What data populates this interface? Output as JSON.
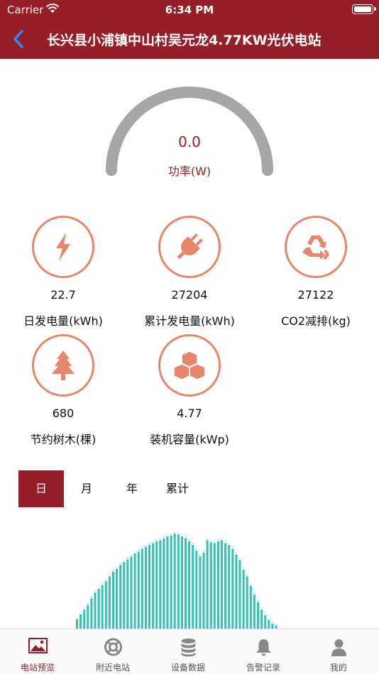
{
  "status_bar": {
    "carrier": "Carrier",
    "time": "6:34 PM"
  },
  "header": {
    "title": "长兴县小浦镇中山村吴元龙4.77KW光伏电站"
  },
  "power": {
    "value": "0.0",
    "label": "功率(W)"
  },
  "stats": [
    {
      "value": "22.7",
      "label": "日发电量(kWh)",
      "icon": "lightning-icon"
    },
    {
      "value": "27204",
      "label": "累计发电量(kWh)",
      "icon": "plug-icon"
    },
    {
      "value": "27122",
      "label": "CO2减排(kg)",
      "icon": "recycle-icon"
    },
    {
      "value": "680",
      "label": "节约树木(棵)",
      "icon": "tree-icon"
    },
    {
      "value": "4.77",
      "label": "装机容量(kWp)",
      "icon": "boxes-icon"
    }
  ],
  "period_tabs": [
    {
      "label": "日",
      "active": true
    },
    {
      "label": "月",
      "active": false
    },
    {
      "label": "年",
      "active": false
    },
    {
      "label": "累计",
      "active": false
    }
  ],
  "chart_data": {
    "type": "bar",
    "values": [
      0.1,
      0.15,
      0.2,
      0.25,
      0.32,
      0.38,
      0.42,
      0.46,
      0.5,
      0.55,
      0.6,
      0.63,
      0.67,
      0.7,
      0.73,
      0.76,
      0.79,
      0.81,
      0.84,
      0.86,
      0.88,
      0.9,
      0.92,
      0.93,
      0.95,
      0.97,
      0.98,
      1.0,
      0.99,
      0.97,
      0.95,
      0.92,
      0.88,
      0.82,
      0.76,
      0.8,
      0.93,
      0.91,
      0.9,
      0.92,
      0.93,
      0.9,
      0.88,
      0.84,
      0.78,
      0.72,
      0.62,
      0.55,
      0.45,
      0.36,
      0.28,
      0.2,
      0.14,
      0.09,
      0.05,
      0.03
    ],
    "color": "#35c2b4"
  },
  "tab_bar": [
    {
      "label": "电站预览",
      "icon": "picture-icon",
      "active": true
    },
    {
      "label": "附近电站",
      "icon": "lifebuoy-icon",
      "active": false
    },
    {
      "label": "设备数据",
      "icon": "database-icon",
      "active": false
    },
    {
      "label": "告警记录",
      "icon": "bell-icon",
      "active": false
    },
    {
      "label": "我的",
      "icon": "user-icon",
      "active": false
    }
  ],
  "colors": {
    "brand": "#961e28",
    "accent": "#e8866d",
    "gauge": "#a6a6a6"
  }
}
